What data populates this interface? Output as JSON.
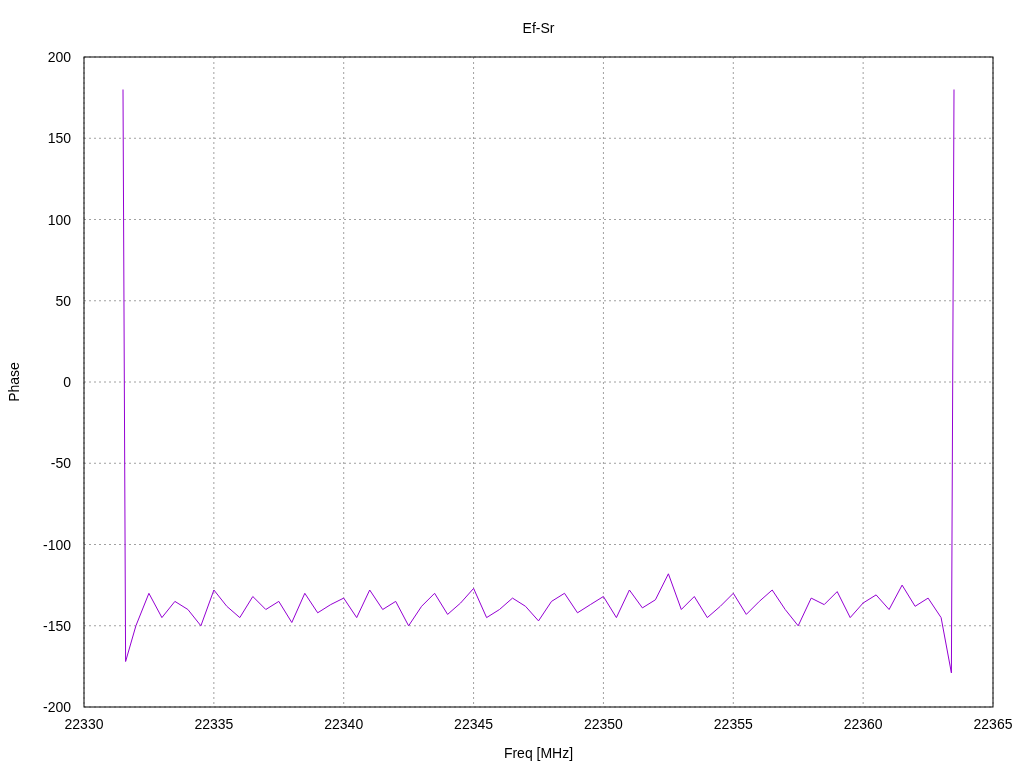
{
  "chart_data": {
    "type": "line",
    "title": "Ef-Sr",
    "xlabel": "Freq [MHz]",
    "ylabel": "Phase",
    "xlim": [
      22330,
      22365
    ],
    "ylim": [
      -200,
      200
    ],
    "grid": true,
    "xticks": [
      22330,
      22335,
      22340,
      22345,
      22350,
      22355,
      22360,
      22365
    ],
    "yticks": [
      -200,
      -150,
      -100,
      -50,
      0,
      50,
      100,
      150,
      200
    ],
    "x": [
      22331.5,
      22331.6,
      22332,
      22332.5,
      22333,
      22333.5,
      22334,
      22334.5,
      22335,
      22335.5,
      22336,
      22336.5,
      22337,
      22337.5,
      22338,
      22338.5,
      22339,
      22339.5,
      22340,
      22340.5,
      22341,
      22341.5,
      22342,
      22342.5,
      22343,
      22343.5,
      22344,
      22344.5,
      22345,
      22345.5,
      22346,
      22346.5,
      22347,
      22347.5,
      22348,
      22348.5,
      22349,
      22349.5,
      22350,
      22350.5,
      22351,
      22351.5,
      22352,
      22352.5,
      22353,
      22353.5,
      22354,
      22354.5,
      22355,
      22355.5,
      22356,
      22356.5,
      22357,
      22357.5,
      22358,
      22358.5,
      22359,
      22359.5,
      22360,
      22360.5,
      22361,
      22361.5,
      22362,
      22362.5,
      22363,
      22363.4,
      22363.5
    ],
    "series": [
      {
        "color": "#9400d3",
        "values": [
          180,
          -172,
          -150,
          -130,
          -145,
          -135,
          -140,
          -150,
          -128,
          -138,
          -145,
          -132,
          -140,
          -135,
          -148,
          -130,
          -142,
          -137,
          -133,
          -145,
          -128,
          -140,
          -135,
          -150,
          -138,
          -130,
          -143,
          -136,
          -127,
          -145,
          -140,
          -133,
          -138,
          -147,
          -135,
          -130,
          -142,
          -137,
          -132,
          -145,
          -128,
          -139,
          -134,
          -118,
          -140,
          -132,
          -145,
          -138,
          -130,
          -143,
          -135,
          -128,
          -140,
          -150,
          -133,
          -137,
          -129,
          -145,
          -136,
          -131,
          -140,
          -125,
          -138,
          -133,
          -145,
          -179,
          180
        ]
      }
    ]
  }
}
